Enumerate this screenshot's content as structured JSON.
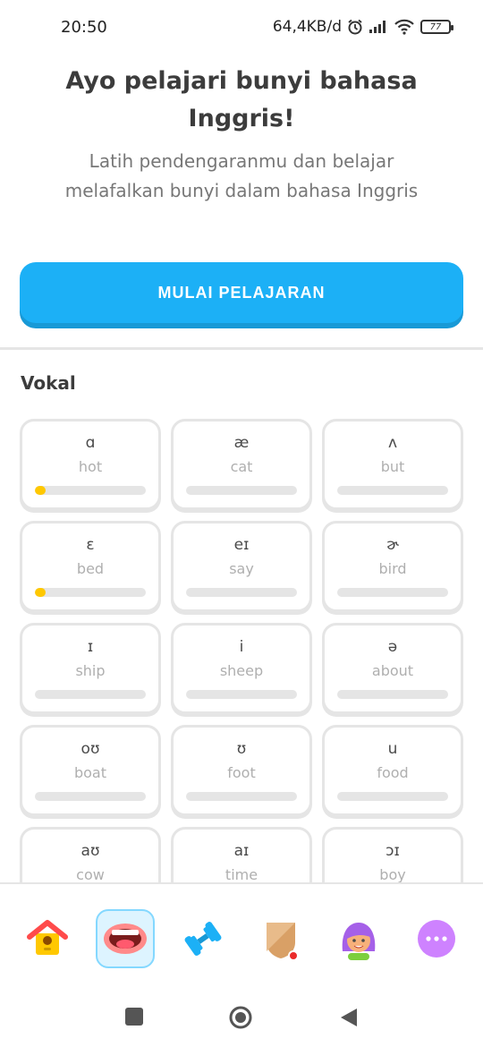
{
  "status_bar": {
    "time": "20:50",
    "network_speed": "64,4KB/d",
    "battery": "77"
  },
  "header": {
    "title": "Ayo pelajari bunyi bahasa Inggris!",
    "subtitle": "Latih pendengaranmu dan belajar melafalkan bunyi dalam bahasa Inggris"
  },
  "start_button": {
    "label": "MULAI PELAJARAN"
  },
  "section": {
    "title": "Vokal"
  },
  "sounds": [
    {
      "symbol": "ɑ",
      "word": "hot",
      "progress": 0.1
    },
    {
      "symbol": "æ",
      "word": "cat",
      "progress": 0
    },
    {
      "symbol": "ʌ",
      "word": "but",
      "progress": 0
    },
    {
      "symbol": "ɛ",
      "word": "bed",
      "progress": 0.1
    },
    {
      "symbol": "eɪ",
      "word": "say",
      "progress": 0
    },
    {
      "symbol": "ɚ",
      "word": "bird",
      "progress": 0
    },
    {
      "symbol": "ɪ",
      "word": "ship",
      "progress": 0
    },
    {
      "symbol": "i",
      "word": "sheep",
      "progress": 0
    },
    {
      "symbol": "ə",
      "word": "about",
      "progress": 0
    },
    {
      "symbol": "oʊ",
      "word": "boat",
      "progress": 0
    },
    {
      "symbol": "ʊ",
      "word": "foot",
      "progress": 0
    },
    {
      "symbol": "u",
      "word": "food",
      "progress": 0
    },
    {
      "symbol": "aʊ",
      "word": "cow",
      "progress": 0
    },
    {
      "symbol": "aɪ",
      "word": "time",
      "progress": 0
    },
    {
      "symbol": "ɔɪ",
      "word": "boy",
      "progress": 0
    }
  ],
  "bottom_nav": [
    {
      "icon": "home-icon",
      "active": false
    },
    {
      "icon": "mouth-icon",
      "active": true
    },
    {
      "icon": "dumbbell-icon",
      "active": false
    },
    {
      "icon": "shield-icon",
      "active": false
    },
    {
      "icon": "profile-avatar-icon",
      "active": false
    },
    {
      "icon": "more-icon",
      "active": false
    }
  ],
  "colors": {
    "accent": "#1cb0f6",
    "progress": "#ffc800",
    "more": "#ce82ff"
  }
}
